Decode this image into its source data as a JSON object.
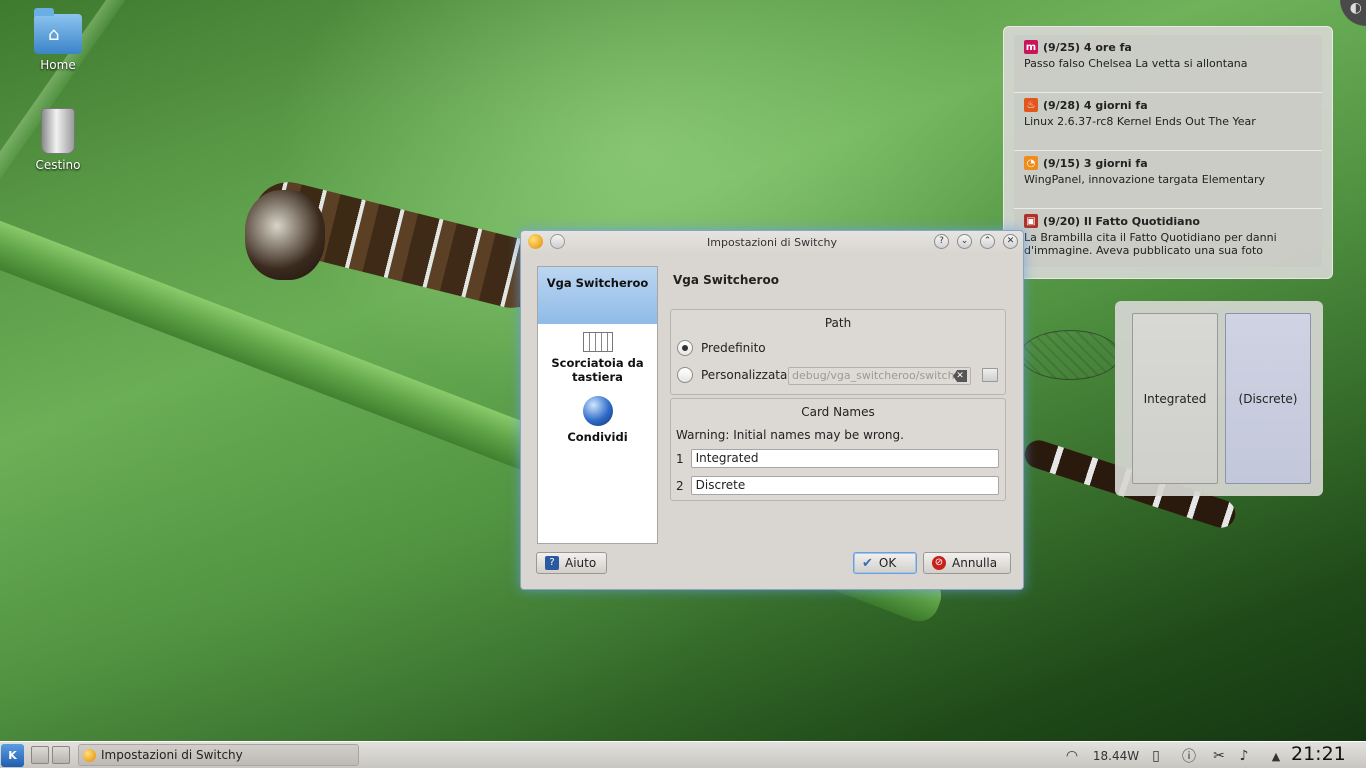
{
  "desktop": {
    "icons": [
      {
        "label": "Home"
      },
      {
        "label": "Cestino"
      }
    ]
  },
  "news": {
    "items": [
      {
        "icon": "m",
        "color": "#c8145a",
        "header": "(9/25) 4 ore fa",
        "text": "Passo falso Chelsea La vetta si allontana"
      },
      {
        "icon": "fire",
        "color": "#e0561c",
        "header": "(9/28) 4 giorni fa",
        "text": "Linux 2.6.37-rc8 Kernel Ends Out The Year"
      },
      {
        "icon": "rss",
        "color": "#f08c1e",
        "header": "(9/15) 3 giorni fa",
        "text": "WingPanel, innovazione targata Elementary"
      },
      {
        "icon": "news",
        "color": "#b0302a",
        "header": "(9/20) Il Fatto Quotidiano",
        "text": "La Brambilla cita il Fatto Quotidiano per danni d'immagine. Aveva pubblicato una sua foto"
      }
    ]
  },
  "gpu_widget": {
    "cards": [
      {
        "label": "Integrated",
        "active": false
      },
      {
        "label": "(Discrete)",
        "active": true
      }
    ]
  },
  "dialog": {
    "title": "Impostazioni di Switchy",
    "sidebar": {
      "items": [
        {
          "label": "Vga Switcheroo",
          "selected": true
        },
        {
          "label": "Scorciatoia da tastiera",
          "icon": "keyboard-icon"
        },
        {
          "label": "Condividi",
          "icon": "globe-icon"
        }
      ]
    },
    "page_title": "Vga Switcheroo",
    "path_group": {
      "title": "Path",
      "option_default": "Predefinito",
      "option_custom": "Personalizzata",
      "selected": "default",
      "custom_value": "debug/vga_switcheroo/switch"
    },
    "card_names": {
      "title": "Card Names",
      "warning": "Warning: Initial names may be wrong.",
      "rows": [
        {
          "index": "1",
          "value": "Integrated"
        },
        {
          "index": "2",
          "value": "Discrete"
        }
      ]
    },
    "buttons": {
      "help": "Aiuto",
      "ok": "OK",
      "cancel": "Annulla"
    }
  },
  "taskbar": {
    "task_label": "Impostazioni di Switchy",
    "power": "18.44W",
    "clock": "21:21",
    "accent": "#1f5fb0"
  }
}
